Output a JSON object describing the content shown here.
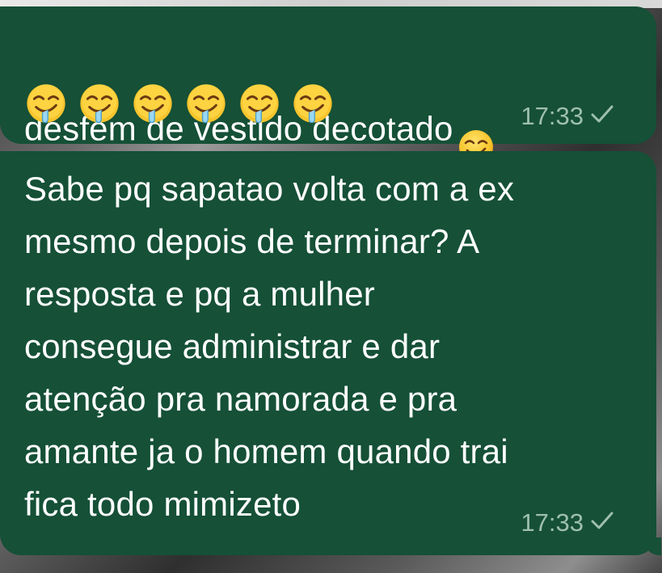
{
  "messages": [
    {
      "text": "desfem de vestido decotado",
      "emoji": "drooling-face",
      "emoji_count": 7,
      "time": "17:33",
      "status": "sent-check"
    },
    {
      "text": "Sabe pq sapatao volta com a ex\nmesmo depois de terminar? A\nresposta e pq a mulher\nconsegue administrar e dar\natenção pra namorada e pra\namante ja o homem quando trai\nfica todo mimizeto",
      "time": "17:33",
      "status": "sent-check"
    }
  ],
  "colors": {
    "bubble": "#155037",
    "text": "#ffffff",
    "meta": "#9fbfae"
  }
}
